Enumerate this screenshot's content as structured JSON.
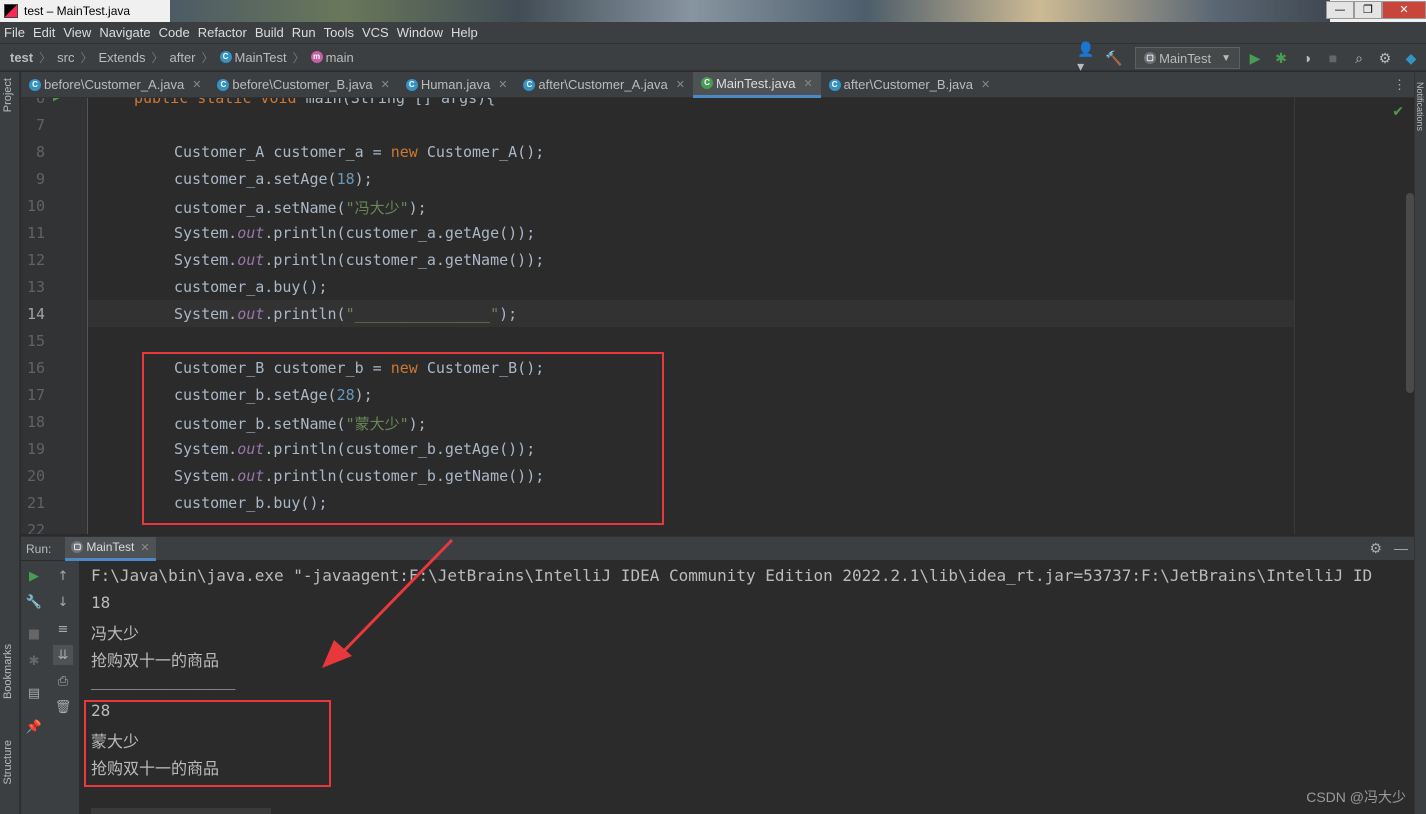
{
  "window": {
    "title": "test – MainTest.java",
    "controls": [
      "—",
      "❐",
      "✕"
    ]
  },
  "menu": [
    "File",
    "Edit",
    "View",
    "Navigate",
    "Code",
    "Refactor",
    "Build",
    "Run",
    "Tools",
    "VCS",
    "Window",
    "Help"
  ],
  "breadcrumb": [
    "test",
    "src",
    "Extends",
    "after",
    "MainTest",
    "main"
  ],
  "run_config": "MainTest",
  "tool_windows": {
    "project": "Project",
    "bookmarks": "Bookmarks",
    "structure": "Structure",
    "notifications": "Notifications"
  },
  "tabs": [
    {
      "label": "before\\Customer_A.java",
      "active": false
    },
    {
      "label": "before\\Customer_B.java",
      "active": false
    },
    {
      "label": "Human.java",
      "active": false
    },
    {
      "label": "after\\Customer_A.java",
      "active": false
    },
    {
      "label": "MainTest.java",
      "active": true
    },
    {
      "label": "after\\Customer_B.java",
      "active": false
    }
  ],
  "editor": {
    "line_numbers": [
      "6",
      "7",
      "8",
      "9",
      "10",
      "11",
      "12",
      "13",
      "14",
      "15",
      "16",
      "17",
      "18",
      "19",
      "20",
      "21",
      "22"
    ],
    "current_line": "14",
    "lines": {
      "l6": {
        "kw": "public static void",
        "rest": " main(String [] args){"
      },
      "l8": {
        "a": "Customer_A customer_a = ",
        "kw": "new",
        "b": " Customer_A();"
      },
      "l9": {
        "a": "customer_a.setAge(",
        "num": "18",
        "b": ");"
      },
      "l10": {
        "a": "customer_a.setName(",
        "str": "\"冯大少\"",
        "b": ");"
      },
      "l11": {
        "a": "System.",
        "fld": "out",
        "b": ".println(customer_a.getAge());"
      },
      "l12": {
        "a": "System.",
        "fld": "out",
        "b": ".println(customer_a.getName());"
      },
      "l13": {
        "a": "customer_a.buy();"
      },
      "l14": {
        "a": "System.",
        "fld": "out",
        "b": ".println(",
        "str": "\"_______________\"",
        "c": ");"
      },
      "l16": {
        "a": "Customer_B customer_b = ",
        "kw": "new",
        "b": " Customer_B();"
      },
      "l17": {
        "a": "customer_b.setAge(",
        "num": "28",
        "b": ");"
      },
      "l18": {
        "a": "customer_b.setName(",
        "str": "\"蒙大少\"",
        "b": ");"
      },
      "l19": {
        "a": "System.",
        "fld": "out",
        "b": ".println(customer_b.getAge());"
      },
      "l20": {
        "a": "System.",
        "fld": "out",
        "b": ".println(customer_b.getName());"
      },
      "l21": {
        "a": "customer_b.buy();"
      }
    }
  },
  "run_panel": {
    "label": "Run:",
    "tab": "MainTest",
    "output": [
      "F:\\Java\\bin\\java.exe \"-javaagent:F:\\JetBrains\\IntelliJ IDEA Community Edition 2022.2.1\\lib\\idea_rt.jar=53737:F:\\JetBrains\\IntelliJ ID",
      "18",
      "冯大少",
      "抢购双十一的商品",
      "_______________",
      "28",
      "蒙大少",
      "抢购双十一的商品"
    ]
  },
  "watermark": "CSDN @冯大少",
  "colors": {
    "annotation_red": "#e8383d",
    "keyword": "#cc7832",
    "string": "#6a8759",
    "number": "#6897bb",
    "field": "#9876aa"
  }
}
